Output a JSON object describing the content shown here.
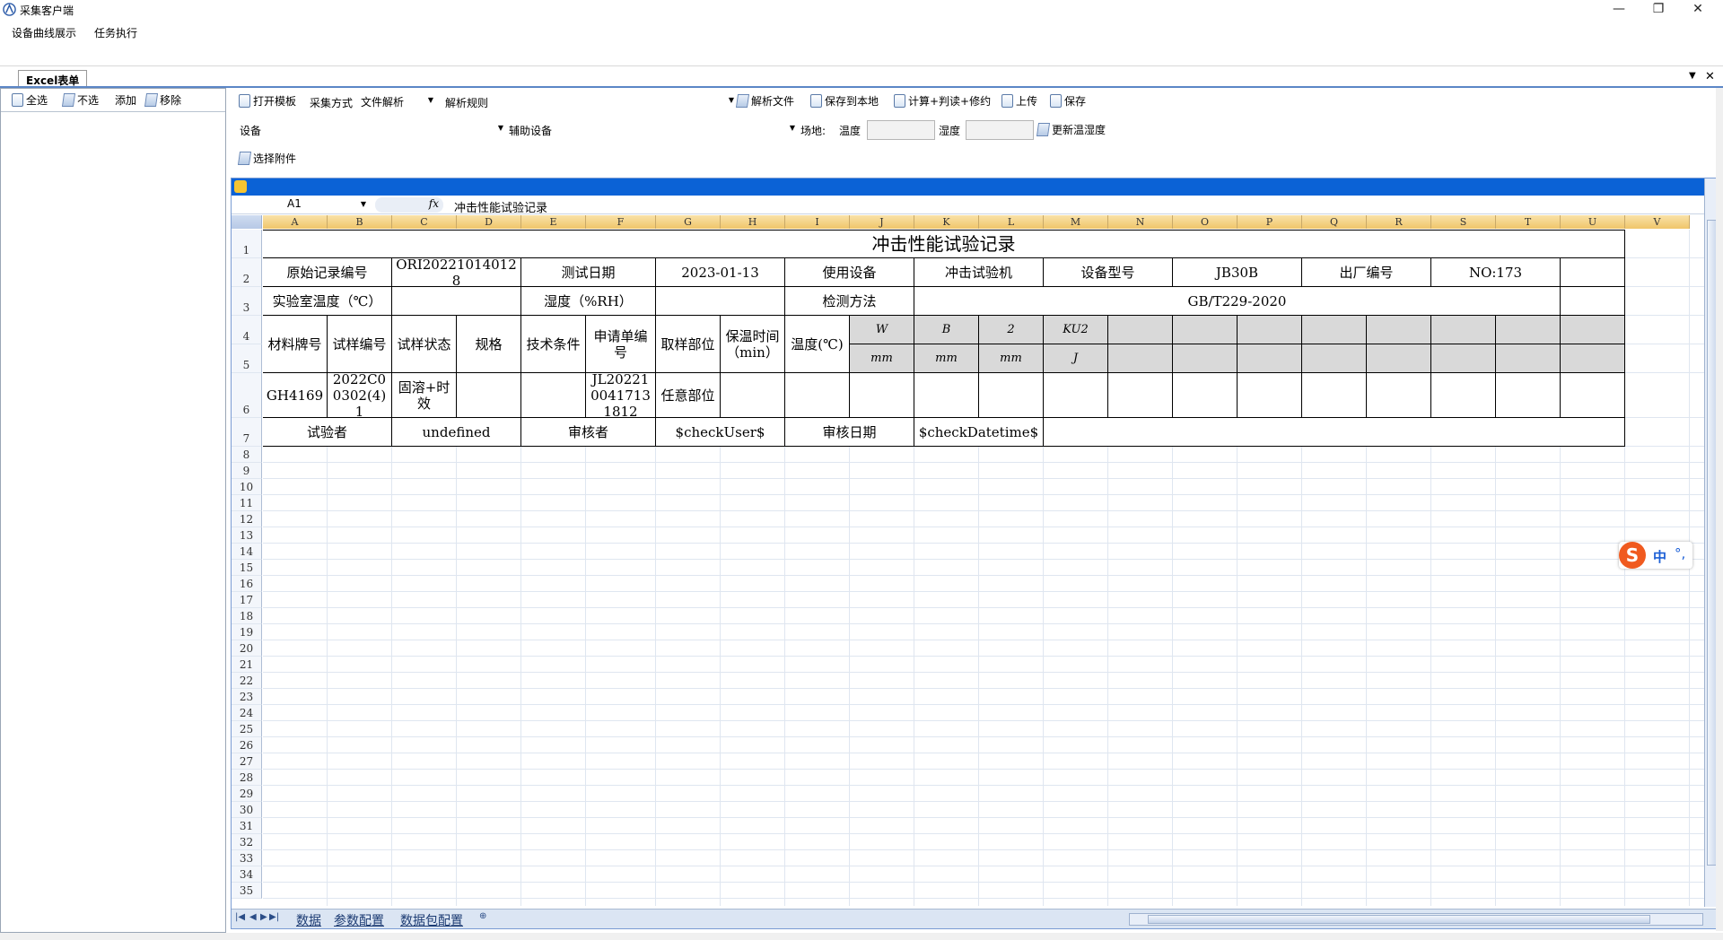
{
  "window": {
    "title": "采集客户端",
    "controls": [
      "—",
      "❐",
      "✕"
    ]
  },
  "menu": {
    "items": [
      "设备曲线展示",
      "任务执行"
    ]
  },
  "doc_tab": {
    "label": "Excel表单"
  },
  "left_toolbar": {
    "select_all": "全选",
    "select_none": "不选",
    "add": "添加",
    "remove": "移除"
  },
  "toolbar1": {
    "open_template": "打开模板",
    "collect_mode_label": "采集方式",
    "collect_mode_value": "文件解析",
    "parse_rule_label": "解析规则",
    "parse_file": "解析文件",
    "save_local": "保存到本地",
    "calc": "计算+判读+修约",
    "upload": "上传",
    "save": "保存"
  },
  "toolbar2": {
    "device_label": "设备",
    "aux_device_label": "辅助设备",
    "site_label": "场地:",
    "temp_label": "温度",
    "humidity_label": "湿度",
    "update_temp": "更新温湿度"
  },
  "toolbar3": {
    "select_attachment": "选择附件"
  },
  "sheet": {
    "name_box": "A1",
    "formula": "冲击性能试验记录",
    "columns": [
      "A",
      "B",
      "C",
      "D",
      "E",
      "F",
      "G",
      "H",
      "I",
      "J",
      "K",
      "L",
      "M",
      "N",
      "O",
      "P",
      "Q",
      "R",
      "S",
      "T",
      "U",
      "V"
    ],
    "rows": [
      "1",
      "2",
      "3",
      "4",
      "5",
      "6",
      "7",
      "8",
      "9",
      "10",
      "11",
      "12",
      "13",
      "14",
      "15",
      "16",
      "17",
      "18",
      "19",
      "20",
      "21",
      "22",
      "23",
      "24",
      "25",
      "26",
      "27",
      "28",
      "29",
      "30",
      "31",
      "32",
      "33",
      "34",
      "35"
    ],
    "title": "冲击性能试验记录",
    "r2": [
      "原始记录编号",
      "ORI202210140128",
      "测试日期",
      "2023-01-13",
      "使用设备",
      "冲击试验机",
      "设备型号",
      "JB30B",
      "出厂编号",
      "NO:173"
    ],
    "r3": [
      "实验室温度（℃）",
      "湿度（%RH）",
      "检测方法",
      "GB/T229-2020"
    ],
    "r45": [
      "材料牌号",
      "试样编号",
      "试样状态",
      "规格",
      "技术条件",
      "申请单编号",
      "取样部位",
      "保温时间（min）",
      "温度(℃)"
    ],
    "r4_units": [
      "W",
      "B",
      "2",
      "KU2"
    ],
    "r5_units": [
      "mm",
      "mm",
      "mm",
      "J"
    ],
    "r6": [
      "GH4169",
      "2022C00302(4)1",
      "固溶+时效",
      "JL2022100417131812",
      "任意部位"
    ],
    "r7": [
      "试验者",
      "undefined",
      "审核者",
      "$checkUser$",
      "审核日期",
      "$checkDatetime$"
    ],
    "tabs": [
      "数据",
      "参数配置",
      "数据包配置"
    ]
  },
  "ime": {
    "logo": "S",
    "mode": "中",
    "punct": "°,"
  }
}
